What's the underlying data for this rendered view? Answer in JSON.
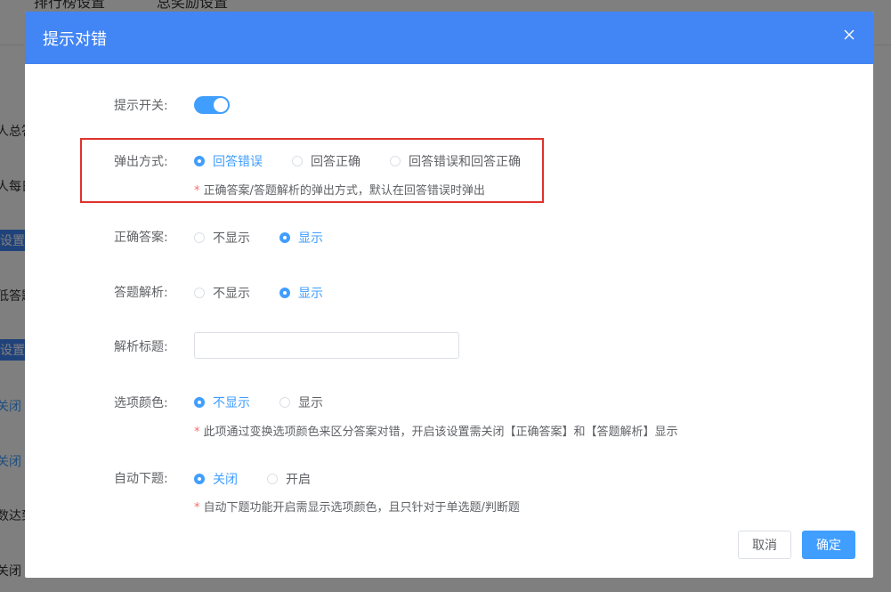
{
  "background": {
    "tabs": [
      "排行榜设置",
      "总奖励设置"
    ],
    "items": [
      {
        "text": "人总答",
        "style": "plain"
      },
      {
        "text": "人每日",
        "style": "plain"
      },
      {
        "text": "设置答",
        "style": "blue-bg"
      },
      {
        "text": "低答题",
        "style": "plain"
      },
      {
        "text": "设置提",
        "style": "blue-bg"
      },
      {
        "text": "关闭",
        "style": "blue-text"
      },
      {
        "text": "关闭",
        "style": "blue-text"
      },
      {
        "text": "数达到",
        "style": "plain"
      },
      {
        "text": "关闭",
        "style": "plain"
      }
    ]
  },
  "dialog": {
    "title": "提示对错",
    "close_icon": "close-icon",
    "fields": {
      "toggle": {
        "label": "提示开关:",
        "on": true
      },
      "popup_mode": {
        "label": "弹出方式:",
        "options": [
          "回答错误",
          "回答正确",
          "回答错误和回答正确"
        ],
        "selected": 0,
        "tip": "正确答案/答题解析的弹出方式，默认在回答错误时弹出"
      },
      "correct_answer": {
        "label": "正确答案:",
        "options": [
          "不显示",
          "显示"
        ],
        "selected": 1
      },
      "analysis": {
        "label": "答题解析:",
        "options": [
          "不显示",
          "显示"
        ],
        "selected": 1
      },
      "analysis_title": {
        "label": "解析标题:",
        "value": "",
        "placeholder": ""
      },
      "option_color": {
        "label": "选项颜色:",
        "options": [
          "不显示",
          "显示"
        ],
        "selected": 0,
        "tip": "此项通过变换选项颜色来区分答案对错，开启该设置需关闭【正确答案】和【答题解析】显示"
      },
      "auto_next": {
        "label": "自动下题:",
        "options": [
          "关闭",
          "开启"
        ],
        "selected": 0,
        "tip": "自动下题功能开启需显示选项颜色，且只针对于单选题/判断题"
      }
    },
    "buttons": {
      "cancel": "取消",
      "confirm": "确定"
    },
    "tip_star": "*"
  },
  "colors": {
    "primary": "#409eff",
    "header": "#4285f4",
    "highlight": "#e0322c"
  }
}
